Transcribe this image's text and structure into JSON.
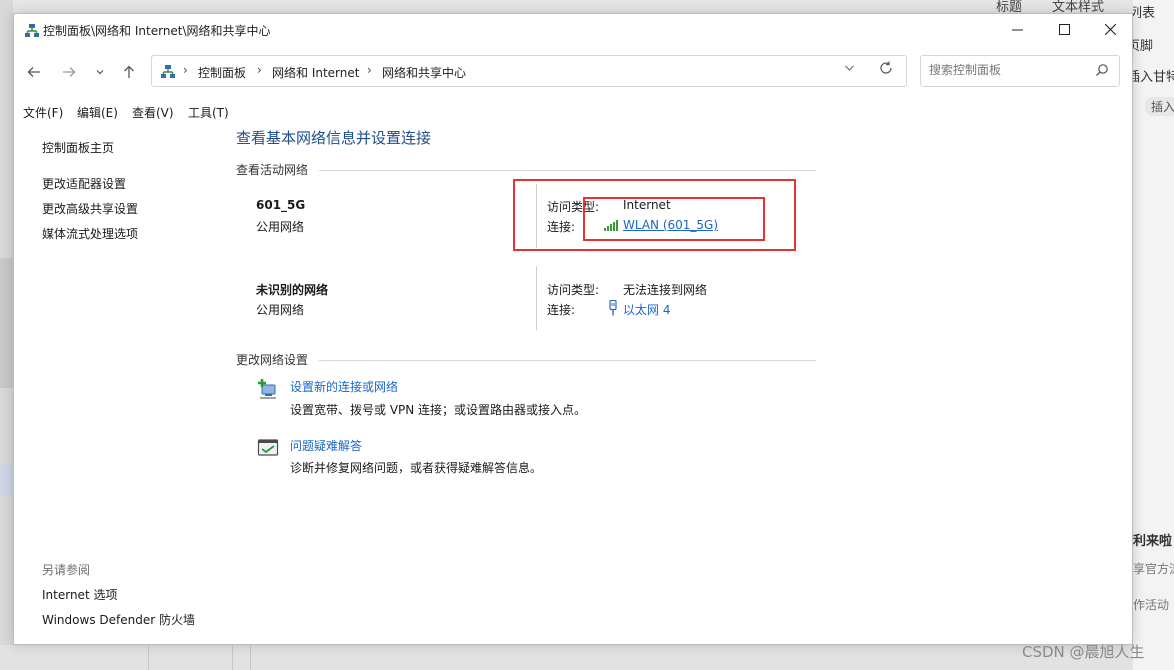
{
  "window": {
    "title": "控制面板\\网络和 Internet\\网络和共享中心"
  },
  "address": {
    "crumbs": [
      "控制面板",
      "网络和 Internet",
      "网络和共享中心"
    ],
    "separator": "›"
  },
  "search": {
    "placeholder": "搜索控制面板"
  },
  "menu": [
    "文件(F)",
    "编辑(E)",
    "查看(V)",
    "工具(T)"
  ],
  "sidebar": {
    "home": "控制面板主页",
    "items": [
      "更改适配器设置",
      "更改高级共享设置",
      "媒体流式处理选项"
    ],
    "see_also_title": "另请参阅",
    "see_also": [
      "Internet 选项",
      "Windows Defender 防火墙"
    ]
  },
  "main": {
    "heading": "查看基本网络信息并设置连接",
    "active_title": "查看活动网络",
    "networks": [
      {
        "name": "601_5G",
        "type": "公用网络",
        "access_label": "访问类型:",
        "access_value": "Internet",
        "conn_label": "连接:",
        "conn_value": "WLAN (601_5G)",
        "conn_icon": "wifi-signal-icon"
      },
      {
        "name": "未识别的网络",
        "type": "公用网络",
        "access_label": "访问类型:",
        "access_value": "无法连接到网络",
        "conn_label": "连接:",
        "conn_value": "以太网 4",
        "conn_icon": "ethernet-plug-icon"
      }
    ],
    "change_title": "更改网络设置",
    "tasks": [
      {
        "link": "设置新的连接或网络",
        "desc": "设置宽带、拨号或 VPN 连接；或设置路由器或接入点。"
      },
      {
        "link": "问题疑难解答",
        "desc": "诊断并修复网络问题，或者获得疑难解答信息。"
      }
    ]
  },
  "background": {
    "right_texts": [
      "标题",
      "文本样式",
      "列表",
      "页脚",
      "插入甘特",
      "插入",
      "利来啦",
      "享官方流",
      "作活动"
    ],
    "watermark": "CSDN @晨旭人生"
  },
  "colors": {
    "link": "#1a66c9",
    "heading": "#1e4e8c",
    "highlight_box": "#e53232"
  }
}
